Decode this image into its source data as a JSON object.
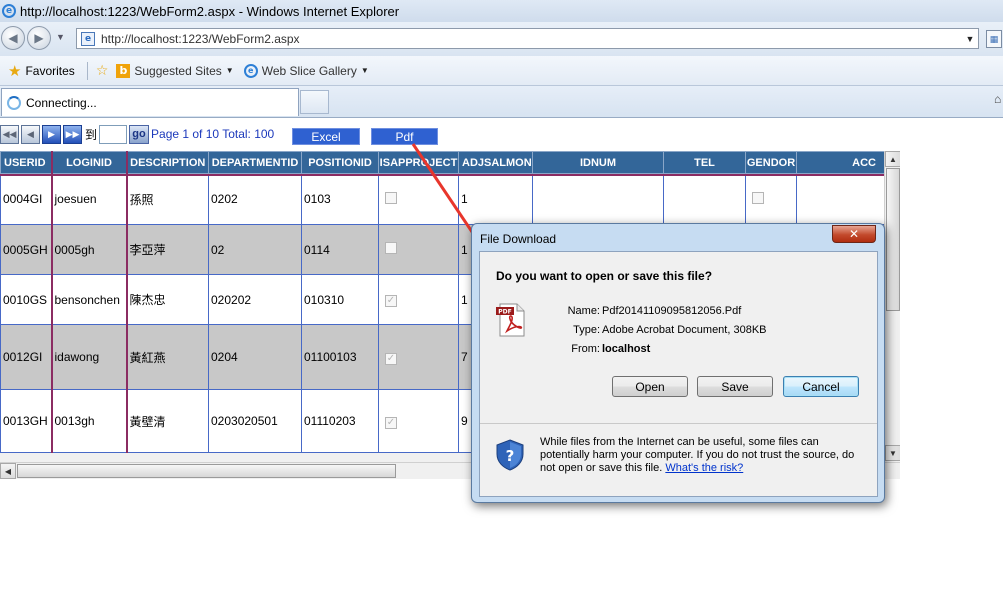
{
  "window": {
    "title": "http://localhost:1223/WebForm2.aspx - Windows Internet Explorer"
  },
  "address": {
    "url": "http://localhost:1223/WebForm2.aspx"
  },
  "favorites_bar": {
    "favorites_label": "Favorites",
    "suggested_label": "Suggested Sites",
    "webslice_label": "Web Slice Gallery"
  },
  "tab": {
    "label": "Connecting..."
  },
  "pager": {
    "to_label": "到",
    "page_input_value": "",
    "go_label": "go",
    "page_text": "Page 1 of 10 Total: 100",
    "excel_label": "Excel",
    "pdf_label": "Pdf"
  },
  "grid": {
    "columns": [
      "USERID",
      "LOGINID",
      "DESCRIPTION",
      "DEPARTMENTID",
      "POSITIONID",
      "ISAPPROJECT",
      "ADJSALMON",
      "IDNUM",
      "TEL",
      "GENDOR",
      "ACC"
    ],
    "rows": [
      {
        "userid": "0004GI",
        "loginid": "joesuen",
        "description": "孫照",
        "departmentid": "0202",
        "positionid": "0103",
        "isapproject": false,
        "adjsalmon": "1",
        "gendor": false
      },
      {
        "userid": "0005GH",
        "loginid": "0005gh",
        "description": "李亞萍",
        "departmentid": "02",
        "positionid": "0114",
        "isapproject": false,
        "adjsalmon": "1",
        "gendor": false
      },
      {
        "userid": "0010GS",
        "loginid": "bensonchen",
        "description": "陳杰忠",
        "departmentid": "020202",
        "positionid": "010310",
        "isapproject": true,
        "adjsalmon": "1",
        "gendor": false
      },
      {
        "userid": "0012GI",
        "loginid": "idawong",
        "description": "黃紅燕",
        "departmentid": "0204",
        "positionid": "01100103",
        "isapproject": true,
        "adjsalmon": "7",
        "gendor": false
      },
      {
        "userid": "0013GH",
        "loginid": "0013gh",
        "description": "黃壁清",
        "departmentid": "0203020501",
        "positionid": "01110203",
        "isapproject": true,
        "adjsalmon": "9",
        "gendor": false
      }
    ]
  },
  "dialog": {
    "title": "File Download",
    "question": "Do you want to open or save this file?",
    "name_label": "Name:",
    "name_value": "Pdf20141109095812056.Pdf",
    "type_label": "Type:",
    "type_value": "Adobe Acrobat Document, 308KB",
    "from_label": "From:",
    "from_value": "localhost",
    "open_label": "Open",
    "save_label": "Save",
    "cancel_label": "Cancel",
    "warning_text": "While files from the Internet can be useful, some files can potentially harm your computer. If you do not trust the source, do not open or save this file.",
    "risk_link": "What's the risk?",
    "pdf_icon_text": "PDF"
  },
  "colors": {
    "grid_header": "#336699",
    "grid_border": "#4769c7",
    "row_alt": "#c8c8c8",
    "export_button": "#2f61d1",
    "arrow": "#e8362c"
  }
}
